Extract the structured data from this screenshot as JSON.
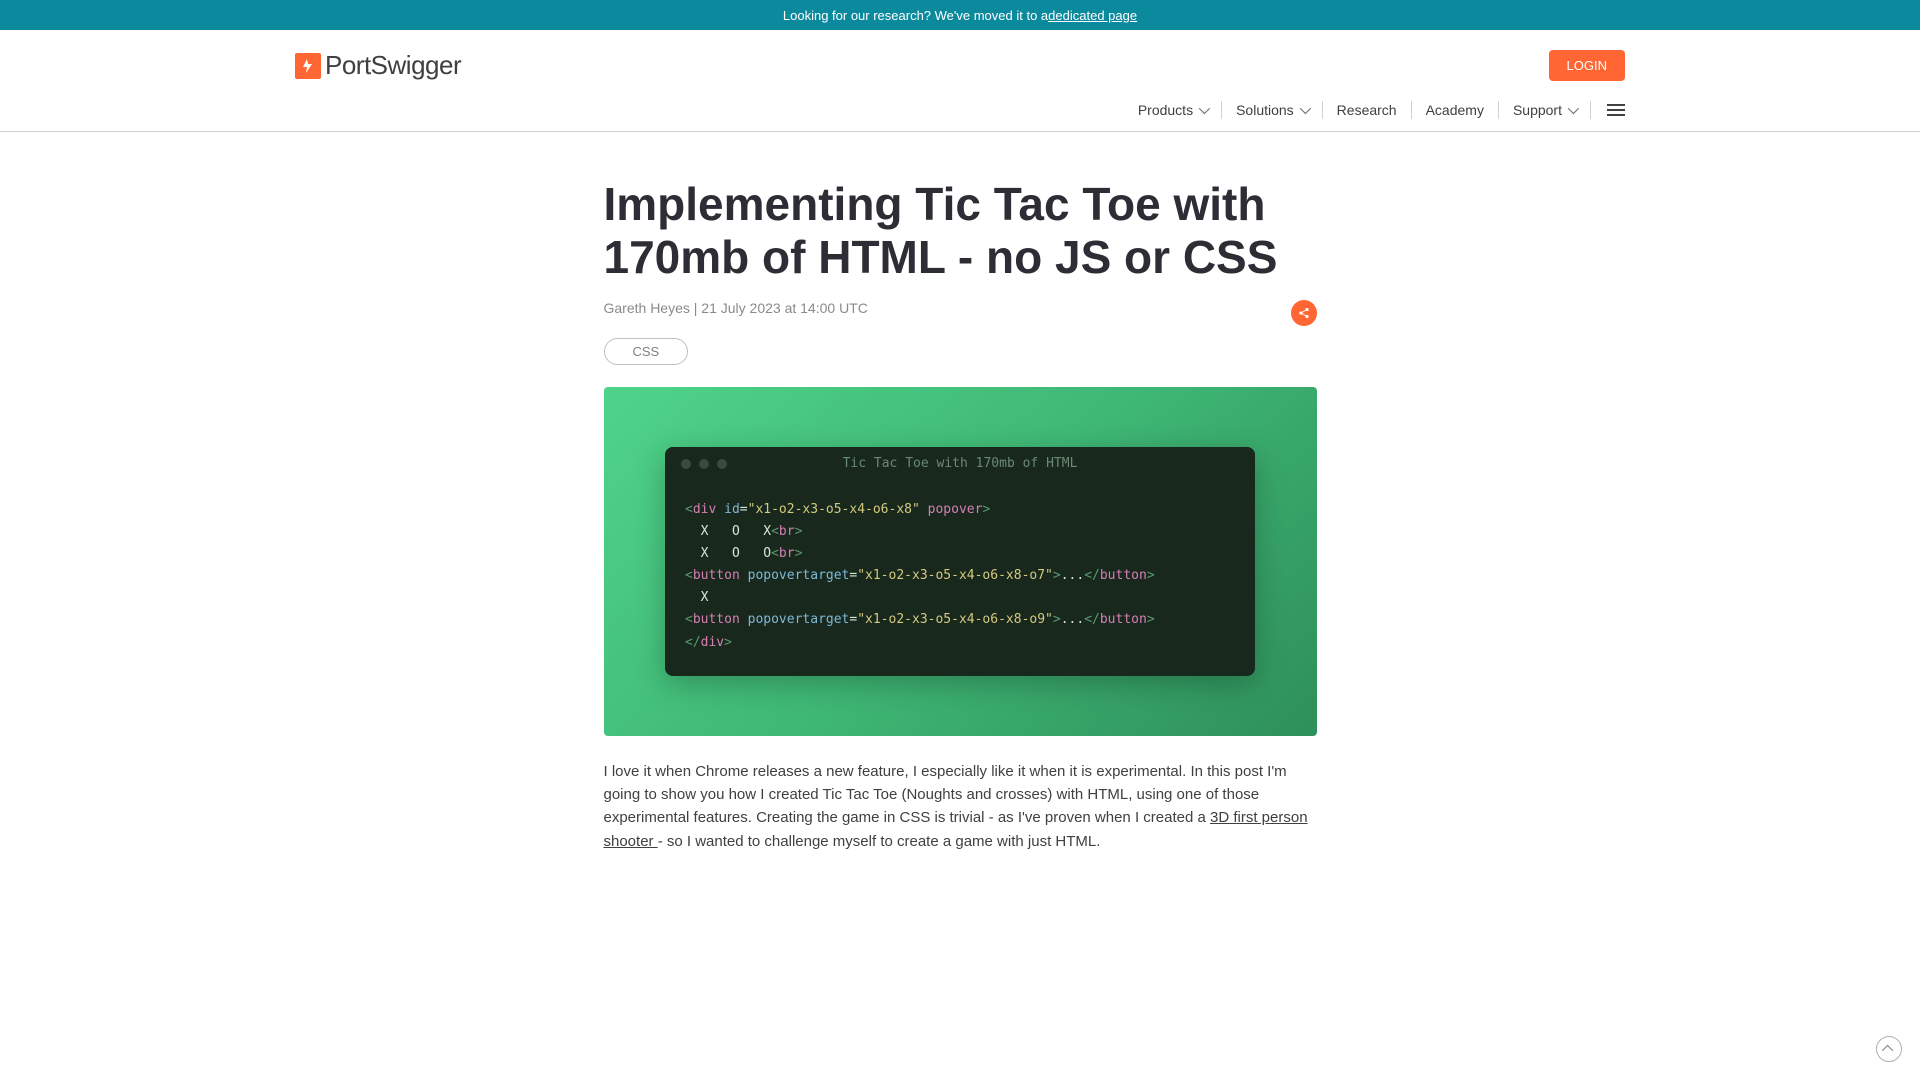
{
  "announce": {
    "prefix": "Looking for our research? We've moved it to a ",
    "link_text": "dedicated page"
  },
  "brand": {
    "name": "PortSwigger",
    "logo_glyph": "⚡"
  },
  "header": {
    "login_label": "LOGIN"
  },
  "nav": {
    "products": "Products",
    "solutions": "Solutions",
    "research": "Research",
    "academy": "Academy",
    "support": "Support"
  },
  "article": {
    "title": "Implementing Tic Tac Toe with 170mb of HTML - no JS or CSS",
    "author": "Gareth Heyes",
    "date": "21 July 2023 at 14:00 UTC",
    "meta_separator": " | ",
    "tag": "CSS",
    "body_part1": "I love it when Chrome releases a new feature, I especially like it when it is experimental. In this post I'm going to show you how I created Tic Tac Toe (Noughts and crosses) with HTML, using one of those experimental features. Creating the game in CSS is trivial - as I've proven when I created a ",
    "body_link": "3D first person shooter ",
    "body_part2": "- so I wanted to challenge myself to create a game with just HTML."
  },
  "code_window": {
    "title": "Tic Tac Toe with 170mb of HTML",
    "lines": [
      "<div id=\"x1-o2-x3-o5-x4-o6-x8\" popover>",
      "  X   O   X<br>",
      "  X   O   O<br>",
      "<button popovertarget=\"x1-o2-x3-o5-x4-o6-x8-o7\">...</button>",
      "  X",
      "<button popovertarget=\"x1-o2-x3-o5-x4-o6-x8-o9\">...</button>",
      "</div>"
    ]
  },
  "colors": {
    "accent": "#ff6633",
    "announce_bg": "#0b8a9e"
  }
}
